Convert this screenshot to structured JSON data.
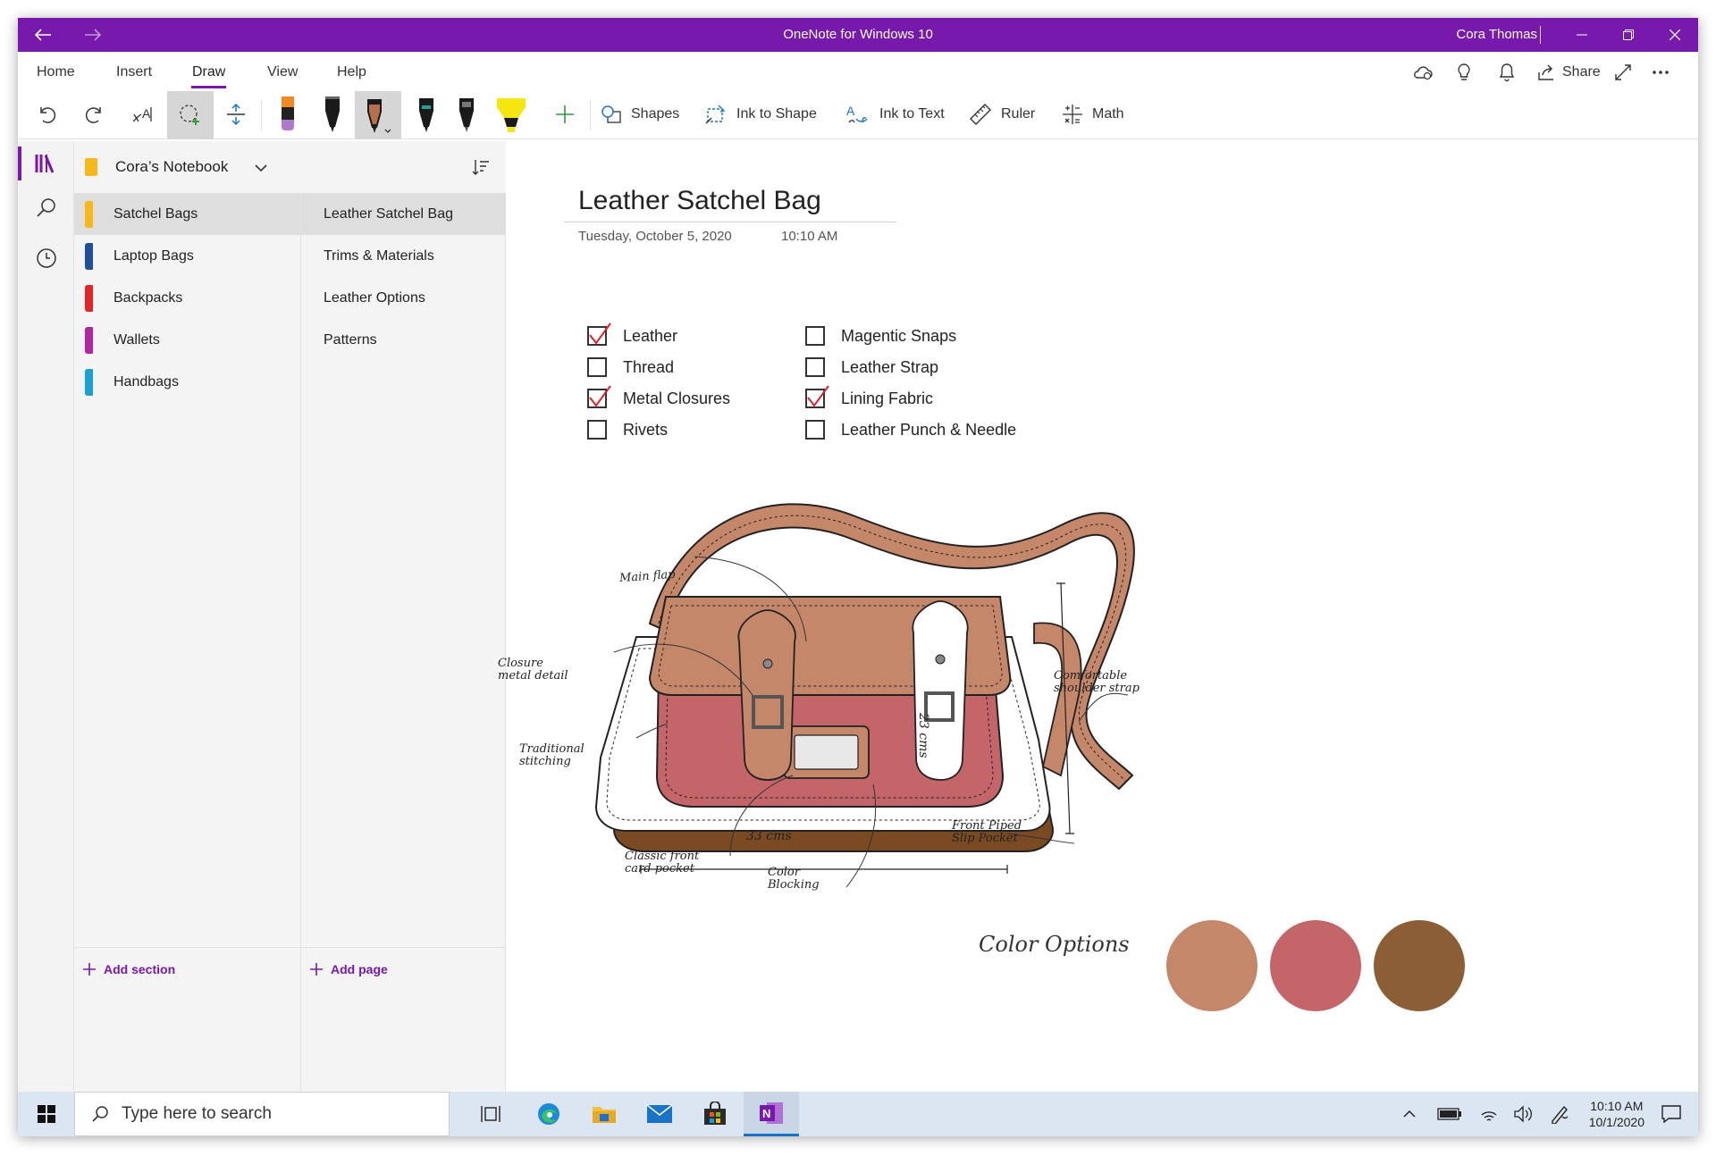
{
  "window": {
    "title": "OneNote for Windows 10",
    "user": "Cora Thomas"
  },
  "menu": {
    "items": [
      "Home",
      "Insert",
      "Draw",
      "View",
      "Help"
    ],
    "active": "Draw",
    "share_label": "Share"
  },
  "toolbar": {
    "shapes_label": "Shapes",
    "ink_to_shape_label": "Ink to Shape",
    "ink_to_text_label": "Ink to Text",
    "ruler_label": "Ruler",
    "math_label": "Math"
  },
  "notebook": {
    "name": "Cora’s Notebook"
  },
  "sections": [
    {
      "label": "Satchel Bags",
      "color": "#f7b81c"
    },
    {
      "label": "Laptop Bags",
      "color": "#1f4e9a"
    },
    {
      "label": "Backpacks",
      "color": "#e3242b"
    },
    {
      "label": "Wallets",
      "color": "#b0279f"
    },
    {
      "label": "Handbags",
      "color": "#1aa0d8"
    }
  ],
  "pages": [
    "Leather Satchel Bag",
    "Trims & Materials",
    "Leather Options",
    "Patterns"
  ],
  "add_section_label": "Add section",
  "add_page_label": "Add page",
  "page": {
    "title": "Leather Satchel Bag",
    "date": "Tuesday, October 5, 2020",
    "time": "10:10 AM",
    "checklist": [
      {
        "label": "Leather",
        "checked": true
      },
      {
        "label": "Thread",
        "checked": false
      },
      {
        "label": "Metal Closures",
        "checked": true
      },
      {
        "label": "Rivets",
        "checked": false
      },
      {
        "label": "Magentic Snaps",
        "checked": false
      },
      {
        "label": "Leather Strap",
        "checked": false
      },
      {
        "label": "Lining Fabric",
        "checked": true
      },
      {
        "label": "Leather Punch & Needle",
        "checked": false
      }
    ],
    "sketch_labels": {
      "main_flap": "Main flap",
      "closure": [
        "Closure",
        "metal detail"
      ],
      "stitching": [
        "Traditional",
        "stitching"
      ],
      "front_pocket": [
        "Classic front",
        "card pocket"
      ],
      "color_blocking": [
        "Color",
        "Blocking"
      ],
      "piped_pocket": [
        "Front Piped",
        "Slip Pocket"
      ],
      "strap": [
        "Comfortable",
        "shoulder strap"
      ],
      "width": "33 cms",
      "height": "23 cms"
    },
    "color_options_label": "Color Options",
    "color_options": [
      "#c4876a",
      "#c46569",
      "#8b5e36"
    ]
  },
  "taskbar": {
    "search_placeholder": "Type here to search",
    "time": "10:10 AM",
    "date": "10/1/2020"
  },
  "colors": {
    "accent": "#7719aa"
  }
}
